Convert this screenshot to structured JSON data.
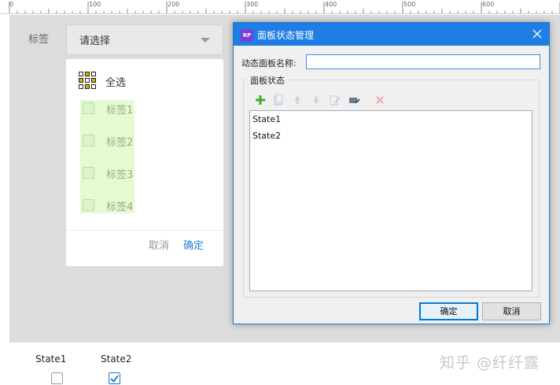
{
  "ruler": {
    "labels": [
      "0",
      "100",
      "200",
      "300",
      "400",
      "500",
      "600"
    ]
  },
  "canvas": {
    "tag_label": "标签",
    "select_placeholder": "请选择",
    "panel": {
      "select_all": "全选",
      "options": [
        "标签1",
        "标签2",
        "标签3",
        "标签4"
      ],
      "cancel": "取消",
      "confirm": "确定"
    }
  },
  "dialog": {
    "app_icon": "RP",
    "title": "面板状态管理",
    "name_label": "动态面板名称:",
    "name_value": "",
    "group_title": "面板状态",
    "toolbar_icons": [
      "add-icon",
      "duplicate-icon",
      "move-up-icon",
      "move-down-icon",
      "edit-icon",
      "edit-all-icon",
      "delete-icon"
    ],
    "states": [
      "State1",
      "State2"
    ],
    "ok": "确定",
    "cancel": "取消"
  },
  "bottom": {
    "items": [
      {
        "label": "State1",
        "checked": false
      },
      {
        "label": "State2",
        "checked": true
      }
    ]
  },
  "watermark": "知乎 @纤纤露",
  "colors": {
    "titlebar": "#1e7ee4",
    "app_icon": "#7b3fd6",
    "option_highlight": "#e4fbd2",
    "link_blue": "#2b7fd4",
    "add_green": "#3fae2a",
    "delete_red": "#e06060"
  }
}
